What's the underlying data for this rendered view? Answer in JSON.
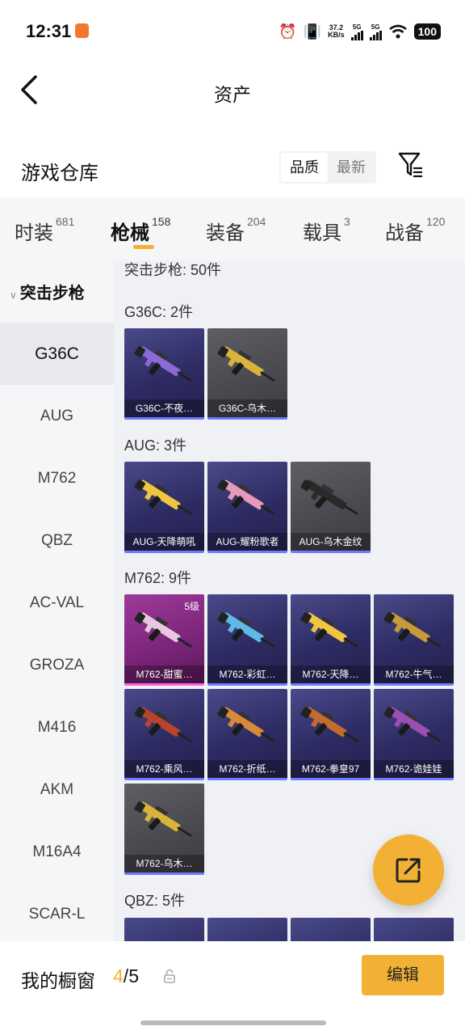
{
  "status_bar": {
    "time": "12:31",
    "speed_value": "37.2",
    "speed_unit": "KB/s",
    "signal1": "5G",
    "signal2": "5G",
    "battery": "100"
  },
  "header": {
    "title": "资产"
  },
  "warehouse": {
    "title": "游戏仓库",
    "sort_options": [
      "品质",
      "最新"
    ]
  },
  "tabs": [
    {
      "label": "时装",
      "count": "681"
    },
    {
      "label": "枪械",
      "count": "158"
    },
    {
      "label": "装备",
      "count": "204"
    },
    {
      "label": "载具",
      "count": "3"
    },
    {
      "label": "战备",
      "count": "120"
    }
  ],
  "sidebar": {
    "category": "突击步枪",
    "items": [
      "G36C",
      "AUG",
      "M762",
      "QBZ",
      "AC-VAL",
      "GROZA",
      "M416",
      "AKM",
      "M16A4",
      "SCAR-L"
    ]
  },
  "main": {
    "category_header": "突击步枪: 50件",
    "sections": [
      {
        "title": "G36C: 2件",
        "items": [
          {
            "name": "G36C-不夜…",
            "style": "purple",
            "gun": "#8b6ad6"
          },
          {
            "name": "G36C-乌木…",
            "style": "gray",
            "gun": "#d8b53a"
          }
        ]
      },
      {
        "title": "AUG: 3件",
        "items": [
          {
            "name": "AUG-天降萌吼",
            "style": "purple",
            "gun": "#f0c640"
          },
          {
            "name": "AUG-耀粉歌者",
            "style": "purple",
            "gun": "#e79ab8"
          },
          {
            "name": "AUG-乌木金纹",
            "style": "gray",
            "gun": "#2a2a2a"
          }
        ]
      },
      {
        "title": "M762: 9件",
        "items": [
          {
            "name": "M762-甜蜜…",
            "style": "pink",
            "gun": "#e6c9df",
            "level": "5级"
          },
          {
            "name": "M762-彩虹…",
            "style": "purple",
            "gun": "#5fb8e6"
          },
          {
            "name": "M762-天降…",
            "style": "purple",
            "gun": "#f0c640"
          },
          {
            "name": "M762-牛气…",
            "style": "purple",
            "gun": "#c79a3a"
          },
          {
            "name": "M762-乘风…",
            "style": "purple",
            "gun": "#b8442c"
          },
          {
            "name": "M762-折纸…",
            "style": "purple",
            "gun": "#d88a3a"
          },
          {
            "name": "M762-拳皇97",
            "style": "purple",
            "gun": "#c46b2e"
          },
          {
            "name": "M762-诡娃娃",
            "style": "purple",
            "gun": "#9b4fb0"
          },
          {
            "name": "M762-乌木…",
            "style": "gray",
            "gun": "#d8b53a"
          }
        ]
      },
      {
        "title": "QBZ: 5件",
        "items": []
      }
    ]
  },
  "bottom": {
    "showcase_label": "我的橱窗",
    "count_current": "4",
    "count_sep": "/",
    "count_total": "5",
    "edit_label": "编辑"
  },
  "colors": {
    "accent": "#f2b134"
  }
}
